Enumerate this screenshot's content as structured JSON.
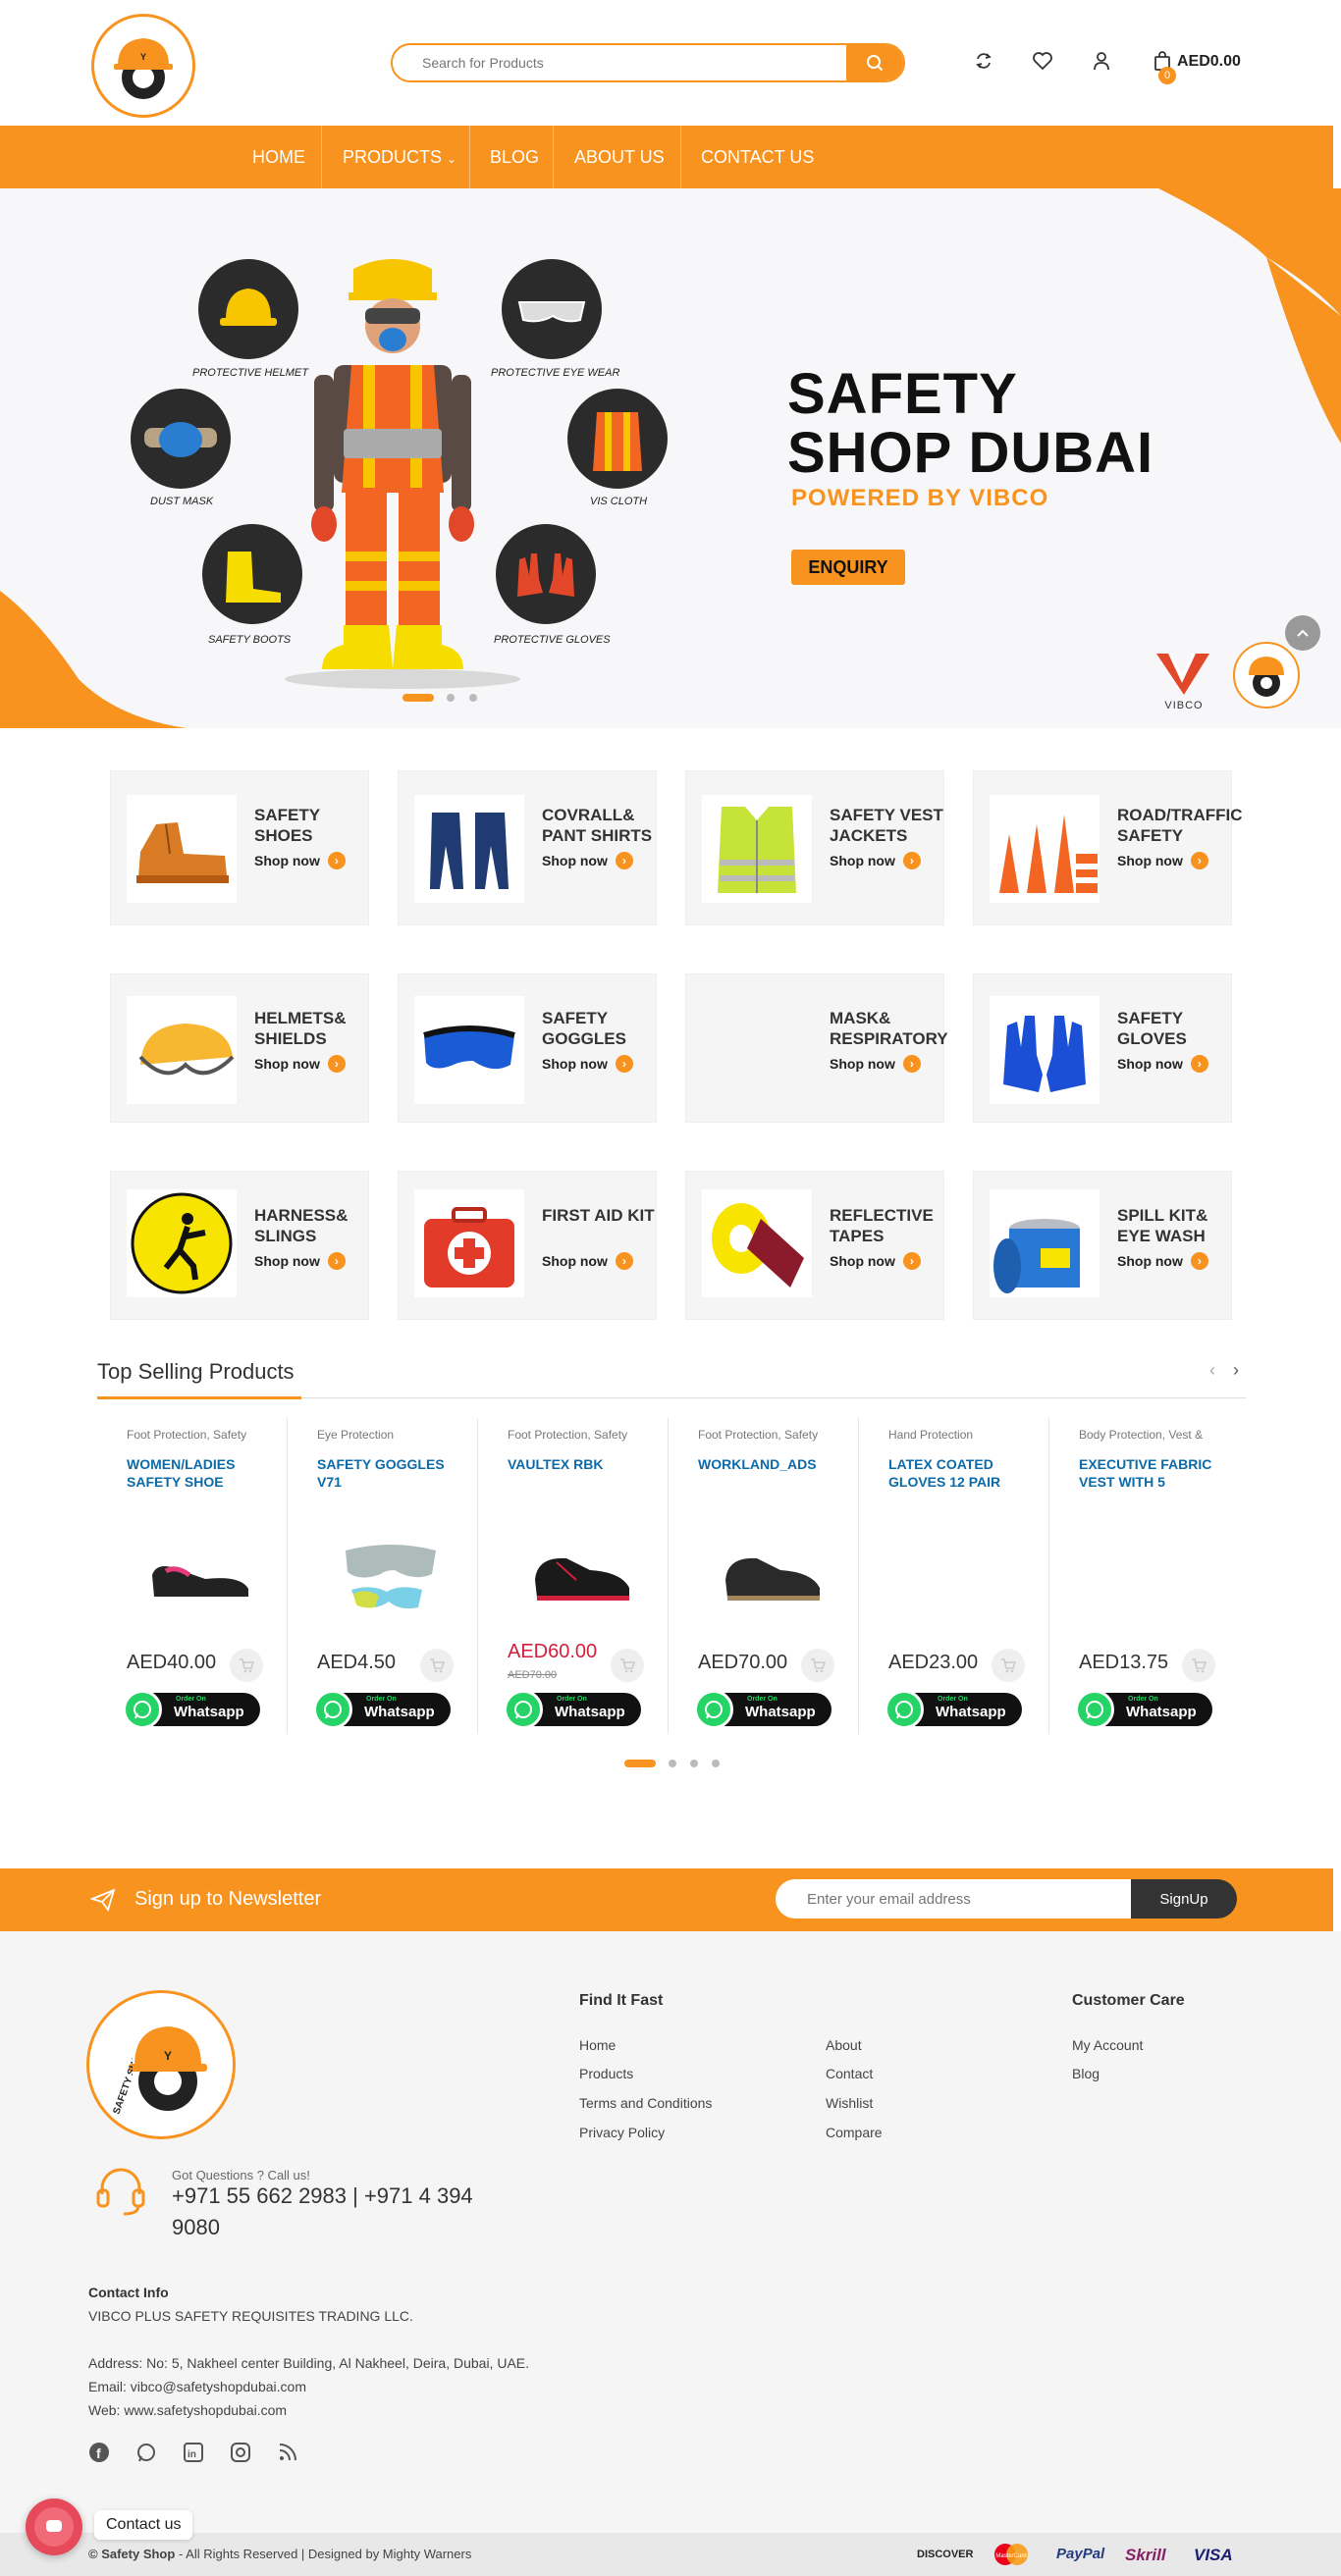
{
  "header": {
    "logo_alt": "SAFETY SHOP DUBAI",
    "search_placeholder": "Search for Products",
    "cart_total": "AED0.00",
    "cart_count": "0"
  },
  "nav": {
    "items": [
      "HOME",
      "PRODUCTS",
      "BLOG",
      "ABOUT US",
      "CONTACT US"
    ]
  },
  "hero": {
    "title_line1": "SAFETY",
    "title_line2": "SHOP DUBAI",
    "subtitle": "POWERED BY VIBCO",
    "button": "ENQUIRY",
    "labels": [
      "PROTECTIVE HELMET",
      "PROTECTIVE EYE WEAR",
      "DUST MASK",
      "VIS CLOTH",
      "SAFETY BOOTS",
      "PROTECTIVE GLOVES"
    ],
    "brand": "VIBCO"
  },
  "categories": [
    {
      "name": "SAFETY SHOES",
      "shop": "Shop now"
    },
    {
      "name": "COVRALL& PANT SHIRTS",
      "shop": "Shop now"
    },
    {
      "name": "SAFETY VEST JACKETS",
      "shop": "Shop now"
    },
    {
      "name": "ROAD/TRAFFIC SAFETY",
      "shop": "Shop now"
    },
    {
      "name": "HELMETS& SHIELDS",
      "shop": "Shop now"
    },
    {
      "name": "SAFETY GOGGLES",
      "shop": "Shop now"
    },
    {
      "name": "MASK& RESPIRATORY",
      "shop": "Shop now"
    },
    {
      "name": "SAFETY GLOVES",
      "shop": "Shop now"
    },
    {
      "name": "HARNESS& SLINGS",
      "shop": "Shop now"
    },
    {
      "name": "FIRST AID KIT",
      "shop": "Shop now"
    },
    {
      "name": "REFLECTIVE TAPES",
      "shop": "Shop now"
    },
    {
      "name": "SPILL KIT& EYE WASH",
      "shop": "Shop now"
    }
  ],
  "top_selling": {
    "title": "Top Selling Products",
    "products": [
      {
        "category": "Foot Protection, Safety",
        "name": "WOMEN/LADIES SAFETY SHOE",
        "price": "AED40.00",
        "old_price": ""
      },
      {
        "category": "Eye Protection",
        "name": "SAFETY GOGGLES V71",
        "price": "AED4.50",
        "old_price": ""
      },
      {
        "category": "Foot Protection, Safety",
        "name": "VAULTEX RBK",
        "price": "AED60.00",
        "old_price": "AED70.00"
      },
      {
        "category": "Foot Protection, Safety",
        "name": "WORKLAND_ADS",
        "price": "AED70.00",
        "old_price": ""
      },
      {
        "category": "Hand Protection",
        "name": "LATEX COATED GLOVES 12 PAIR",
        "price": "AED23.00",
        "old_price": ""
      },
      {
        "category": "Body Protection, Vest &",
        "name": "EXECUTIVE FABRIC VEST WITH 5",
        "price": "AED13.75",
        "old_price": ""
      }
    ],
    "wa_small": "Order On",
    "wa_big": "Whatsapp"
  },
  "newsletter": {
    "text": "Sign up to Newsletter",
    "placeholder": "Enter your email address",
    "button": "SignUp"
  },
  "footer": {
    "logo_text": "SAFETY SHOP DUBAI",
    "questions": "Got Questions ? Call us!",
    "phone": "+971 55 662 2983 | +971 4 394 9080",
    "find_fast": "Find It Fast",
    "links_col1": [
      "Home",
      "Products",
      "Terms and Conditions",
      "Privacy Policy"
    ],
    "links_col2": [
      "About",
      "Contact",
      "Wishlist",
      "Compare"
    ],
    "customer_care": "Customer Care",
    "links_col3": [
      "My Account",
      "Blog"
    ],
    "contact_info": "Contact Info",
    "company": "VIBCO PLUS SAFETY REQUISITES TRADING LLC.",
    "address": "Address: No: 5, Nakheel center Building, Al Nakheel, Deira, Dubai, UAE.",
    "email": "Email: vibco@safetyshopdubai.com",
    "web": "Web: www.safetyshopdubai.com",
    "copyright_brand": "© Safety Shop",
    "copyright_rest": " - All Rights Reserved | Designed by Mighty Warners",
    "payments": [
      "DISCOVER",
      "MasterCard",
      "PayPal",
      "Skrill",
      "VISA"
    ],
    "contact_us": "Contact us"
  }
}
